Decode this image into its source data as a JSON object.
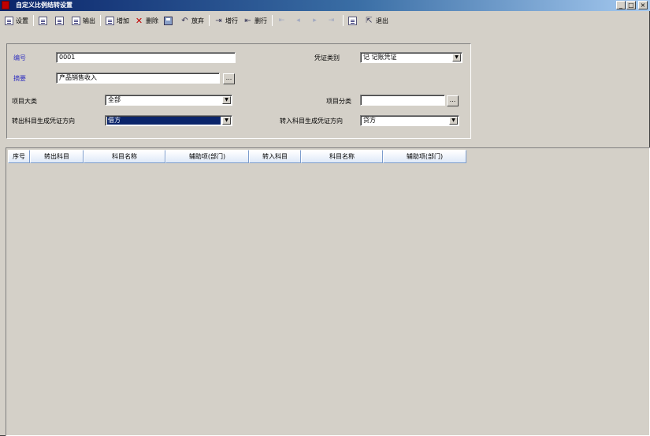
{
  "window": {
    "title": "自定义比例结转设置",
    "minimize_glyph": "_",
    "maximize_glyph": "□",
    "close_glyph": "×"
  },
  "toolbar": {
    "items": [
      {
        "label": "设置",
        "icon": "setup-icon",
        "disabled": false
      },
      {
        "label": "",
        "icon": "print-icon",
        "disabled": false
      },
      {
        "label": "",
        "icon": "preview-icon",
        "disabled": false
      },
      {
        "label": "输出",
        "icon": "export-icon",
        "disabled": false
      },
      {
        "label": "增加",
        "icon": "add-icon",
        "disabled": false
      },
      {
        "label": "删除",
        "icon": "delete-icon",
        "disabled": false
      },
      {
        "label": "",
        "icon": "save-icon",
        "disabled": false
      },
      {
        "label": "放弃",
        "icon": "undo-icon",
        "disabled": false
      },
      {
        "label": "增行",
        "icon": "add-row-icon",
        "disabled": false
      },
      {
        "label": "删行",
        "icon": "delete-row-icon",
        "disabled": false
      },
      {
        "label": "",
        "icon": "first-icon",
        "disabled": true
      },
      {
        "label": "",
        "icon": "prev-icon",
        "disabled": true
      },
      {
        "label": "",
        "icon": "next-icon",
        "disabled": true
      },
      {
        "label": "",
        "icon": "last-icon",
        "disabled": true
      },
      {
        "label": "",
        "icon": "help-icon",
        "disabled": false
      },
      {
        "label": "退出",
        "icon": "exit-icon",
        "disabled": false
      }
    ]
  },
  "form": {
    "code_label": "编号",
    "code_value": "0001",
    "summary_label": "摘要",
    "summary_value": "产品销售收入",
    "ellipsis": "...",
    "voucher_type_label": "凭证类别",
    "voucher_type_value": "记  记账凭证",
    "project_major_label": "项目大类",
    "project_major_value": "全部",
    "project_class_label": "项目分类",
    "project_class_value": "",
    "out_direction_label": "转出科目生成凭证方向",
    "out_direction_value": "借方",
    "in_direction_label": "转入科目生成凭证方向",
    "in_direction_value": "贷方",
    "dropdown_glyph": "▼"
  },
  "grid": {
    "columns": [
      "序号",
      "转出科目",
      "科目名称",
      "辅助项(部门)",
      "转入科目",
      "科目名称",
      "辅助项(部门)"
    ]
  }
}
